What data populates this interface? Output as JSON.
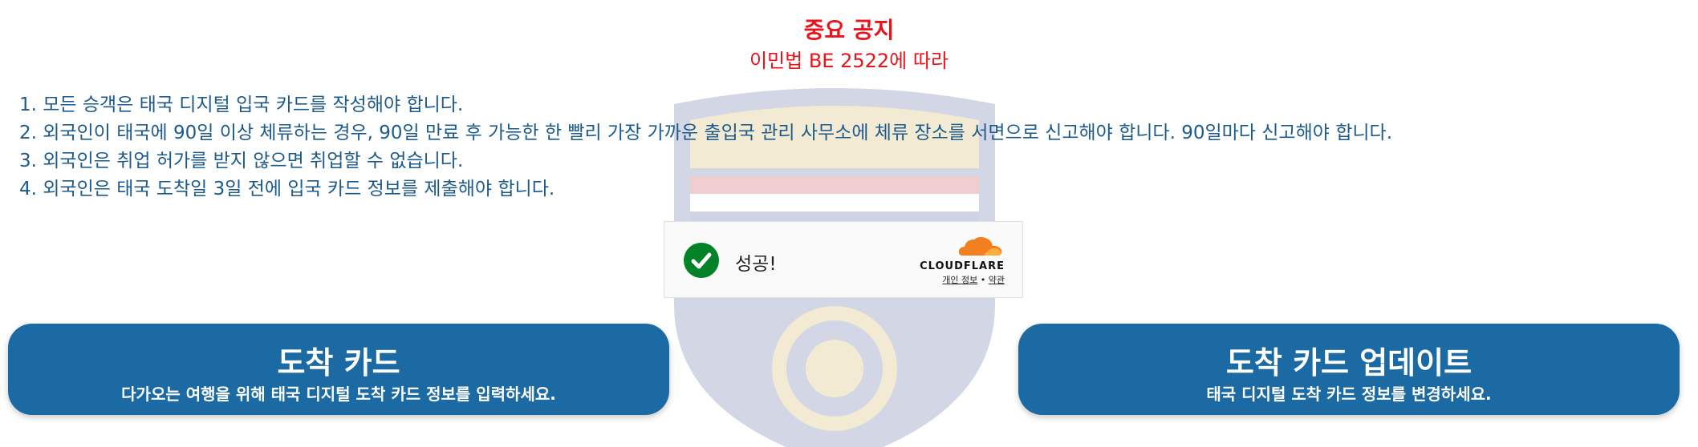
{
  "notice": {
    "title": "중요 공지",
    "subtitle": "이민법 BE 2522에 따라"
  },
  "rules": [
    "1. 모든 승객은 태국 디지털 입국 카드를 작성해야 합니다.",
    "2. 외국인이 태국에 90일 이상 체류하는 경우, 90일 만료 후 가능한 한 빨리 가장 가까운 출입국 관리 사무소에 체류 장소를 서면으로 신고해야 합니다. 90일마다 신고해야 합니다.",
    "3. 외국인은 취업 허가를 받지 않으면 취업할 수 없습니다.",
    "4. 외국인은 태국 도착일 3일 전에 입국 카드 정보를 제출해야 합니다."
  ],
  "cloudflare": {
    "status": "성공!",
    "brand": "CLOUDFLARE",
    "privacy_link": "개인 정보",
    "separator": "•",
    "terms_link": "약관",
    "check_color": "#038127",
    "cloud_color": "#f38020"
  },
  "buttons": {
    "arrival": {
      "title": "도착 카드",
      "description": "다가오는 여행을 위해 태국 디지털 도착 카드 정보를 입력하세요."
    },
    "update": {
      "title": "도착 카드 업데이트",
      "description": "태국 디지털 도착 카드 정보를 변경하세요."
    }
  },
  "colors": {
    "notice_red": "#e8141b",
    "text_blue": "#1d5a8c",
    "button_blue": "#1b6aa3"
  },
  "icons": {
    "watermark": "royal-thai-police-immigration-emblem",
    "success": "check-circle-icon",
    "brand_logo": "cloudflare-cloud-icon"
  }
}
